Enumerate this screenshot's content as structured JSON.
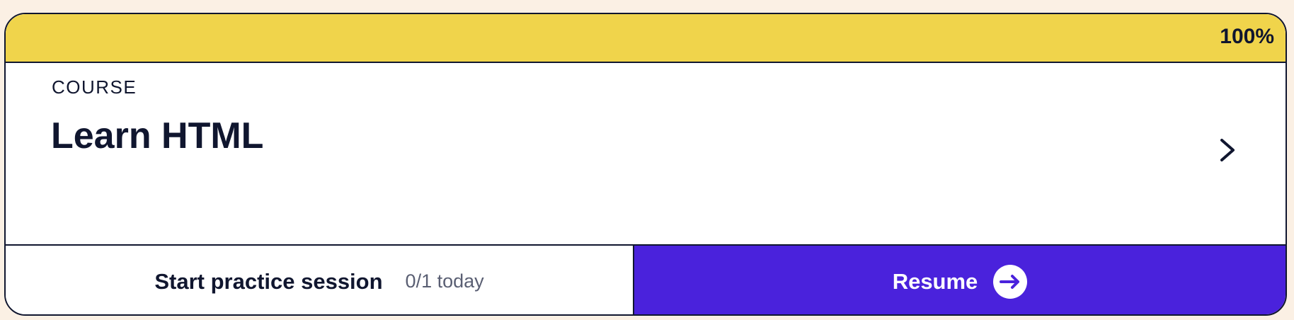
{
  "progress": {
    "label": "100%",
    "fraction": 1.0
  },
  "course": {
    "kicker": "COURSE",
    "title": "Learn HTML"
  },
  "footer": {
    "practice_label": "Start practice session",
    "practice_count": "0/1 today",
    "resume_label": "Resume"
  },
  "colors": {
    "page_background": "#fbf0e4",
    "progress_fill": "#f0d44b",
    "resume_background": "#4a22dc",
    "text_dark": "#10162f",
    "text_muted": "#5a5f73"
  },
  "icons": {
    "open_course": "chevron-right-icon",
    "resume": "arrow-right-circle-icon"
  }
}
